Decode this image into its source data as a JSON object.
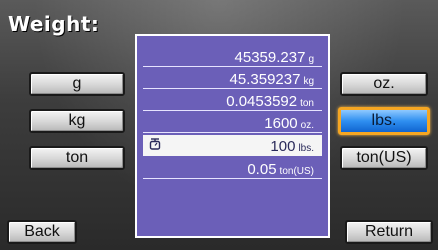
{
  "title": "Weight:",
  "left_buttons": [
    {
      "label": "g"
    },
    {
      "label": "kg"
    },
    {
      "label": "ton"
    }
  ],
  "right_buttons": [
    {
      "label": "oz."
    },
    {
      "label": "lbs.",
      "selected": true
    },
    {
      "label": "ton(US)"
    }
  ],
  "results": [
    {
      "value": "45359.237",
      "unit": "g"
    },
    {
      "value": "45.359237",
      "unit": "kg"
    },
    {
      "value": "0.0453592",
      "unit": "ton"
    },
    {
      "value": "1600",
      "unit": "oz."
    },
    {
      "value": "100",
      "unit": "lbs.",
      "highlighted": true,
      "icon": "scale-icon"
    },
    {
      "value": "0.05",
      "unit": "ton(US)"
    }
  ],
  "footer": {
    "back_label": "Back",
    "return_label": "Return"
  },
  "colors": {
    "panel": "#6b5fb8",
    "selected_border": "#f5a623",
    "selected_fill": "#2f8ff0"
  }
}
